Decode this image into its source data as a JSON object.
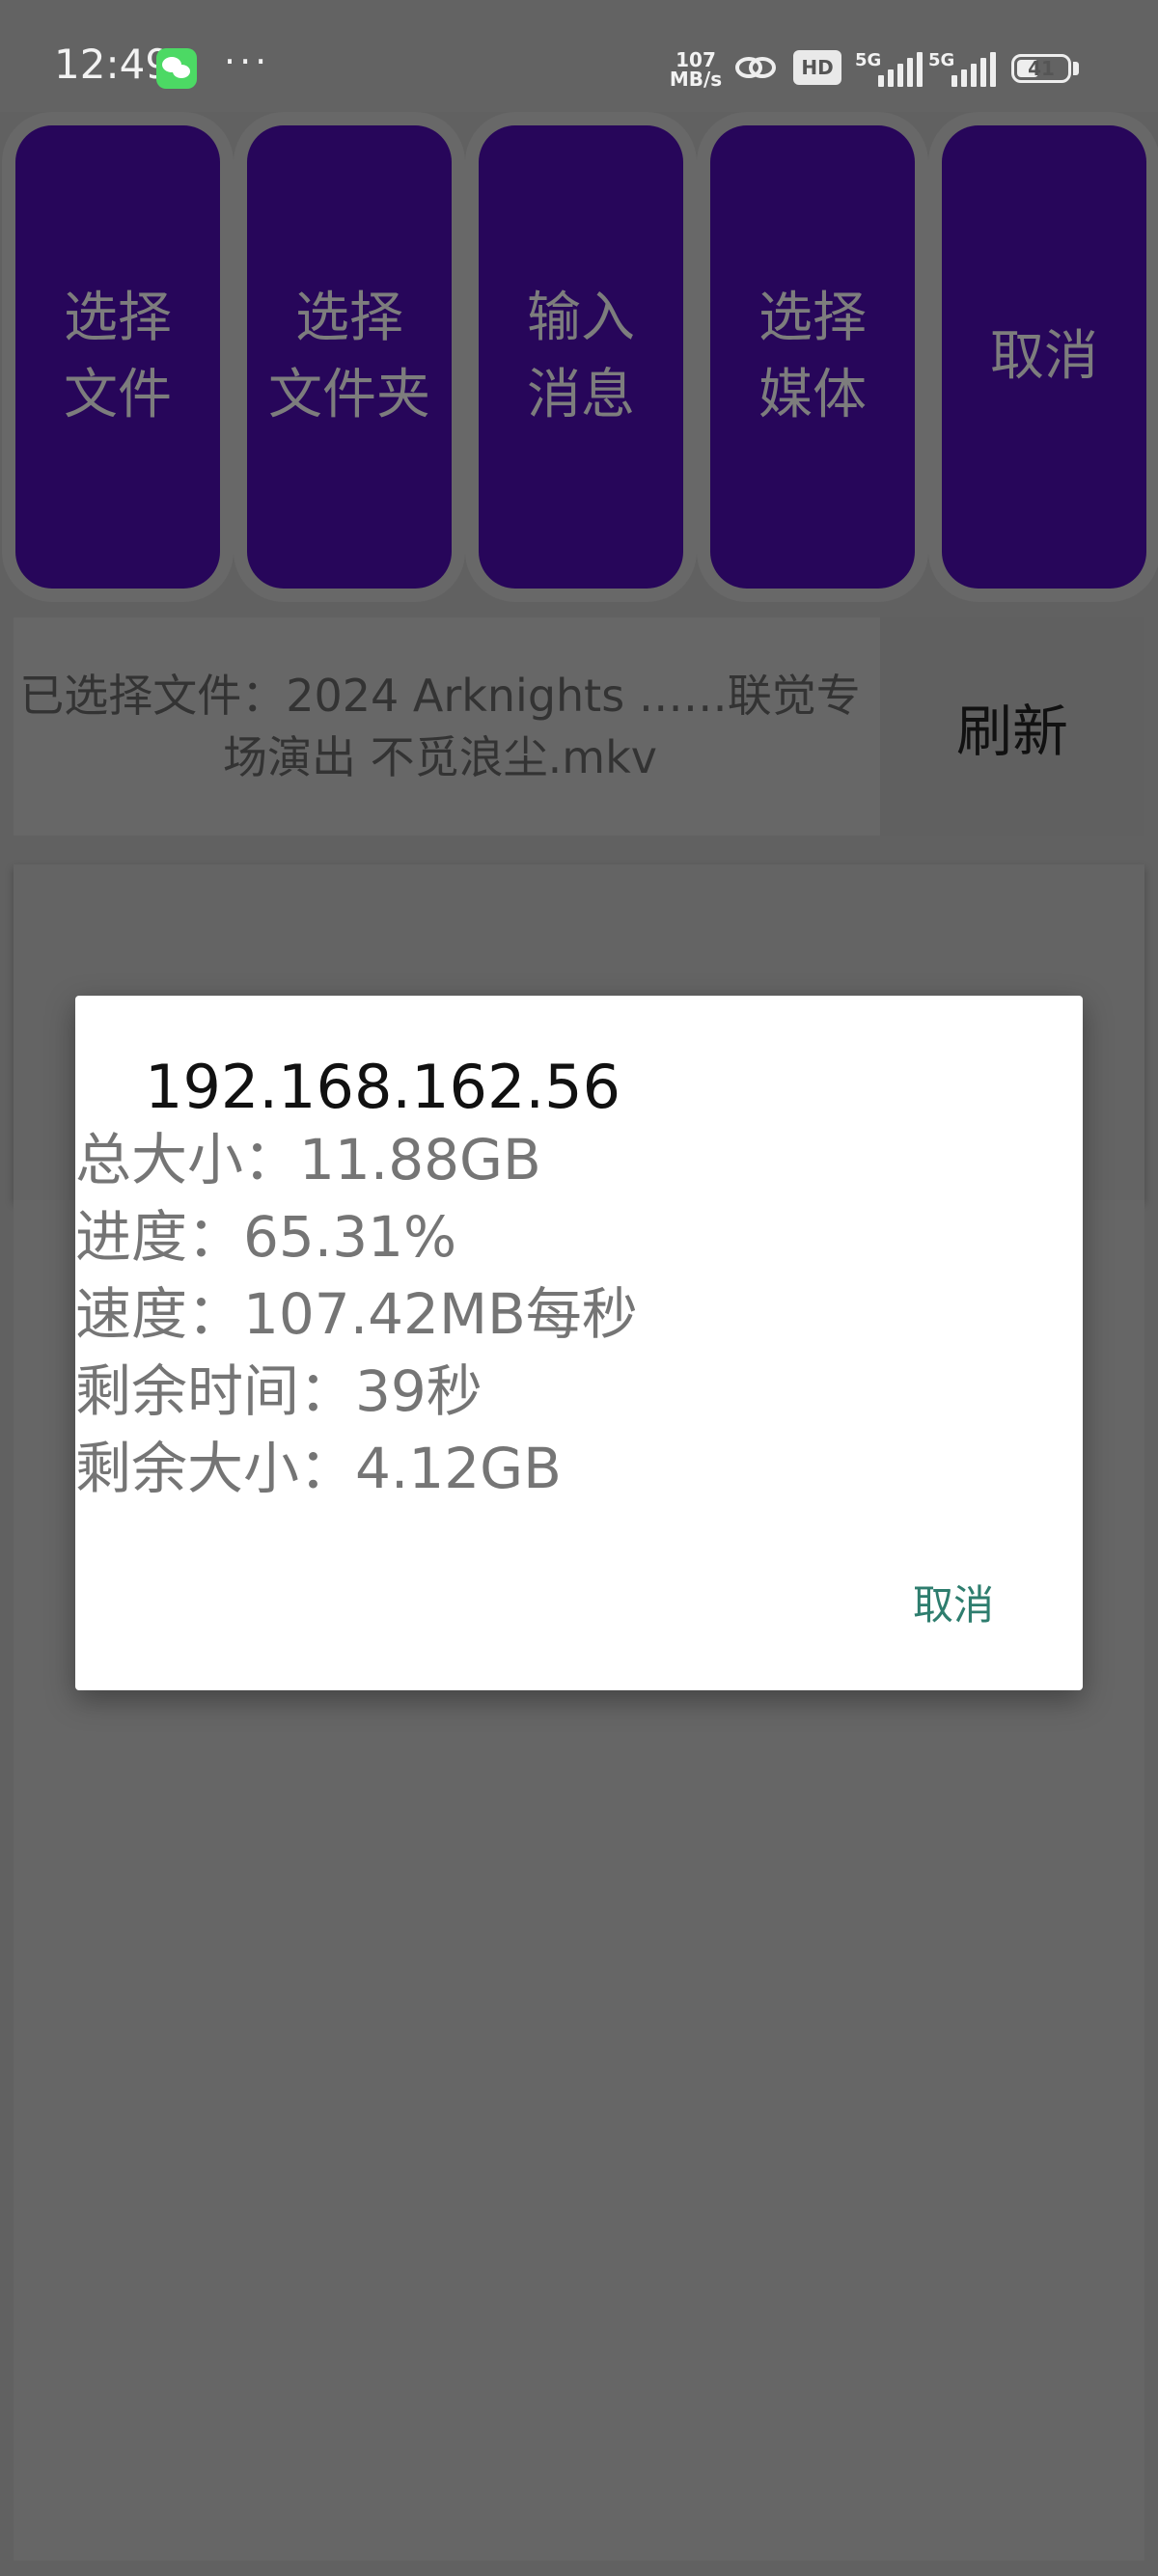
{
  "status_bar": {
    "time": "12:49",
    "speed_value": "107",
    "speed_unit": "MB/s",
    "hd_label": "HD",
    "sig1_label": "5G",
    "sig2_label": "5G",
    "battery": "41",
    "icons": [
      "wechat-icon",
      "more-icon",
      "link-icon",
      "hd-icon",
      "signal-icon",
      "battery-icon"
    ]
  },
  "actions": {
    "select_file": "选择\n文件",
    "select_folder": "选择\n文件夹",
    "input_message": "输入\n消息",
    "select_media": "选择\n媒体",
    "cancel": "取消"
  },
  "file_info": {
    "text": "已选择文件：2024 Arknights ……联觉专场演出 不觅浪尘.mkv",
    "refresh": "刷新"
  },
  "dialog": {
    "title": "192.168.162.56",
    "total_size": "总大小：11.88GB",
    "progress": "进度：65.31%",
    "speed": "速度：107.42MB每秒",
    "time_left": "剩余时间：39秒",
    "size_left": "剩余大小：4.12GB",
    "cancel": "取消"
  },
  "colors": {
    "button_bg": "#27065a",
    "dialog_action": "#2e7d6e",
    "overlay": "#616161"
  }
}
